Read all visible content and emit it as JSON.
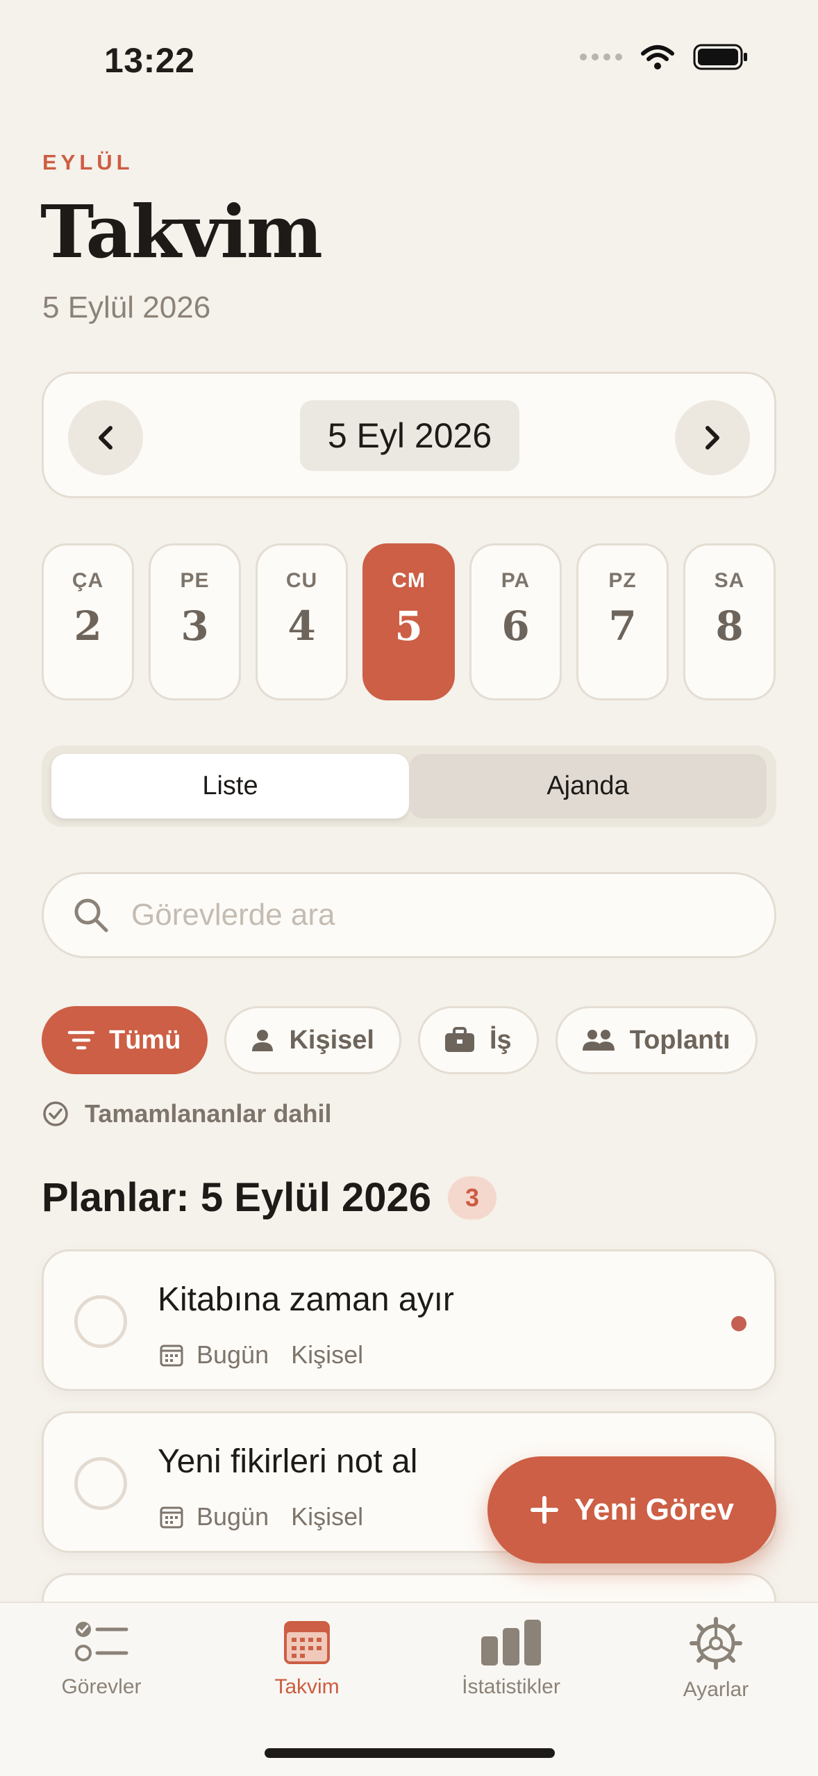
{
  "status_bar": {
    "time": "13:22"
  },
  "header": {
    "eyebrow": "EYLÜL",
    "title": "Takvim",
    "subtitle": "5 Eylül 2026"
  },
  "date_nav": {
    "current_date": "5 Eyl 2026"
  },
  "week_days": [
    {
      "name": "ÇA",
      "num": "2"
    },
    {
      "name": "PE",
      "num": "3"
    },
    {
      "name": "CU",
      "num": "4"
    },
    {
      "name": "CM",
      "num": "5",
      "selected": true
    },
    {
      "name": "PA",
      "num": "6"
    },
    {
      "name": "PZ",
      "num": "7"
    },
    {
      "name": "SA",
      "num": "8"
    }
  ],
  "segment": {
    "list_label": "Liste",
    "agenda_label": "Ajanda",
    "selected": "Liste"
  },
  "search": {
    "placeholder": "Görevlerde ara"
  },
  "filters": {
    "all": "Tümü",
    "personal": "Kişisel",
    "work": "İş",
    "meeting": "Toplantı",
    "selected": "Tümü"
  },
  "include_completed": "Tamamlananlar dahil",
  "section": {
    "title": "Planlar: 5 Eylül 2026",
    "count": "3"
  },
  "tasks": [
    {
      "title": "Kitabına zaman ayır",
      "date": "Bugün",
      "category": "Kişisel"
    },
    {
      "title": "Yeni fikirleri not al",
      "date": "Bugün",
      "category": "Kişisel"
    }
  ],
  "fab": {
    "label": "Yeni Görev"
  },
  "tabbar": {
    "tasks": "Görevler",
    "calendar": "Takvim",
    "stats": "İstatistikler",
    "settings": "Ayarlar",
    "active": "Takvim"
  },
  "colors": {
    "accent": "#cc5f45",
    "background": "#f5f1eb",
    "card": "#fdfbf7",
    "muted_text": "#7d746b",
    "priority_dot": "#c45f52"
  }
}
